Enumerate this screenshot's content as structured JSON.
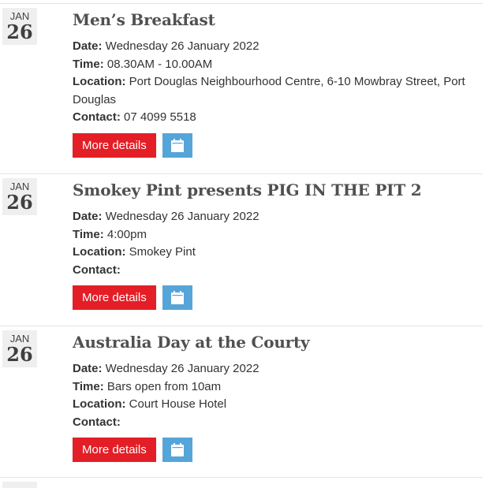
{
  "events": [
    {
      "month": "JAN",
      "day": "26",
      "title": "Men’s Breakfast",
      "date_label": "Date:",
      "date_value": " Wednesday 26 January 2022",
      "time_label": "Time:",
      "time_value": " 08.30AM - 10.00AM",
      "location_label": "Location:",
      "location_value": " Port Douglas Neighbourhood Centre, 6-10 Mowbray Street, Port Douglas",
      "contact_label": "Contact:",
      "contact_value": " 07 4099 5518",
      "more_label": "More details",
      "calendar_icon": "calendar-icon"
    },
    {
      "month": "JAN",
      "day": "26",
      "title": "Smokey Pint presents PIG IN THE PIT 2",
      "date_label": "Date:",
      "date_value": " Wednesday 26 January 2022",
      "time_label": "Time:",
      "time_value": " 4:00pm",
      "location_label": "Location:",
      "location_value": " Smokey Pint",
      "contact_label": "Contact:",
      "contact_value": "",
      "more_label": "More details",
      "calendar_icon": "calendar-icon"
    },
    {
      "month": "JAN",
      "day": "26",
      "title": "Australia Day at the Courty",
      "date_label": "Date:",
      "date_value": " Wednesday 26 January 2022",
      "time_label": "Time:",
      "time_value": " Bars open from 10am",
      "location_label": "Location:",
      "location_value": " Court House Hotel",
      "contact_label": "Contact:",
      "contact_value": "",
      "more_label": "More details",
      "calendar_icon": "calendar-icon"
    }
  ],
  "colors": {
    "more_button": "#e41e26",
    "calendar_button": "#55a5d9",
    "date_box": "#efefef",
    "title": "#505050"
  }
}
